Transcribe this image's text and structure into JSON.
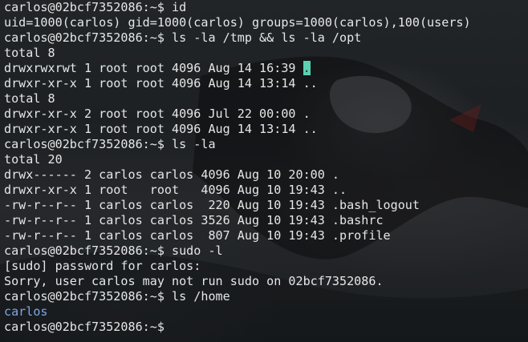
{
  "terminal": {
    "prompt": "carlos@02bcf7352086:~$",
    "lines": [
      {
        "type": "cmd",
        "text": " id"
      },
      {
        "type": "out",
        "text": "uid=1000(carlos) gid=1000(carlos) groups=1000(carlos),100(users)"
      },
      {
        "type": "cmd",
        "text": " ls -la /tmp && ls -la /opt"
      },
      {
        "type": "out",
        "text": "total 8"
      },
      {
        "type": "out",
        "pre": "drwxrwxrwt 1 root root 4096 Aug 14 16:39 ",
        "mark": "."
      },
      {
        "type": "out",
        "text": "drwxr-xr-x 1 root root 4096 Aug 14 13:14 .."
      },
      {
        "type": "out",
        "text": "total 8"
      },
      {
        "type": "out",
        "text": "drwxr-xr-x 2 root root 4096 Jul 22 00:00 ."
      },
      {
        "type": "out",
        "text": "drwxr-xr-x 1 root root 4096 Aug 14 13:14 .."
      },
      {
        "type": "cmd",
        "text": " ls -la"
      },
      {
        "type": "out",
        "text": "total 20"
      },
      {
        "type": "out",
        "text": "drwx------ 2 carlos carlos 4096 Aug 10 20:00 ."
      },
      {
        "type": "out",
        "text": "drwxr-xr-x 1 root   root   4096 Aug 10 19:43 .."
      },
      {
        "type": "out",
        "text": "-rw-r--r-- 1 carlos carlos  220 Aug 10 19:43 .bash_logout"
      },
      {
        "type": "out",
        "text": "-rw-r--r-- 1 carlos carlos 3526 Aug 10 19:43 .bashrc"
      },
      {
        "type": "out",
        "text": "-rw-r--r-- 1 carlos carlos  807 Aug 10 19:43 .profile"
      },
      {
        "type": "cmd",
        "text": " sudo -l"
      },
      {
        "type": "out",
        "text": "[sudo] password for carlos:"
      },
      {
        "type": "out",
        "text": "Sorry, user carlos may not run sudo on 02bcf7352086."
      },
      {
        "type": "cmd",
        "text": " ls /home"
      },
      {
        "type": "dir",
        "text": "carlos"
      },
      {
        "type": "cmd",
        "text": ""
      }
    ]
  },
  "colors": {
    "text": "#e6e6e6",
    "directory": "#7ea6e8",
    "highlight": "#5ad1b3"
  }
}
